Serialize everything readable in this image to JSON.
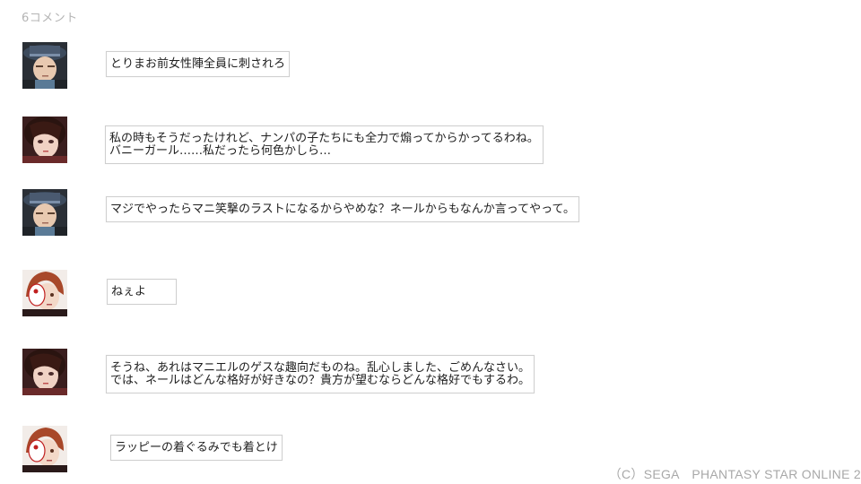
{
  "header": {
    "comment_count": "6コメント"
  },
  "comments": [
    {
      "avatar": "avatar-male-hat",
      "text": "とりまお前女性陣全員に刺されろ"
    },
    {
      "avatar": "avatar-female-dark-hair",
      "text": "私の時もそうだったけれど、ナンパの子たちにも全力で煽ってからかってるわね。\nバニーガール……私だったら何色かしら…"
    },
    {
      "avatar": "avatar-male-hat",
      "text": "マジでやったらマニ笑撃のラストになるからやめな？ネールからもなんか言ってやって。"
    },
    {
      "avatar": "avatar-red-hair-mask",
      "text": "ねぇよ"
    },
    {
      "avatar": "avatar-female-dark-hair",
      "text": "そうね、あれはマニエルのゲスな趣向だものね。乱心しました、ごめんなさい。\nでは、ネールはどんな格好が好きなの？貴方が望むならどんな格好でもするわ。"
    },
    {
      "avatar": "avatar-red-hair-mask",
      "text": "ラッピーの着ぐるみでも着とけ"
    }
  ],
  "footer": {
    "copyright": "（C）SEGA　PHANTASY STAR ONLINE 2"
  },
  "colors": {
    "count_text": "#b4b4b4",
    "bubble_border": "#cfcfcf",
    "copyright_text": "#a8a8a8"
  }
}
